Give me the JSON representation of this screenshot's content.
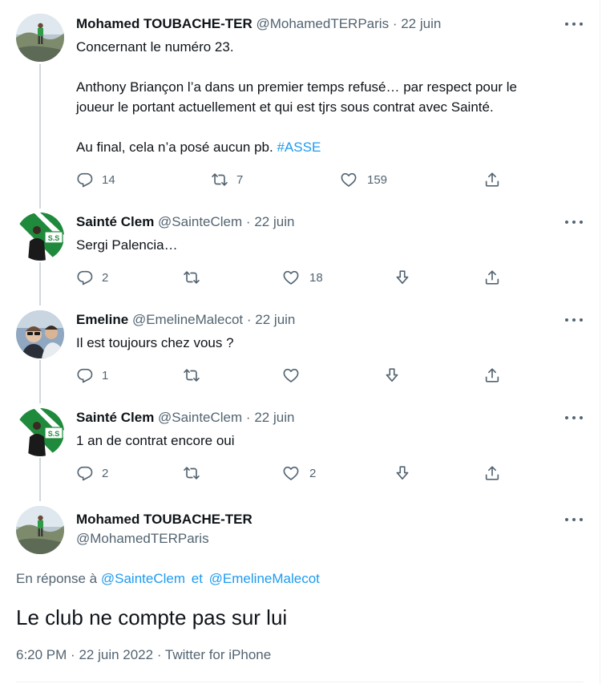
{
  "tweets": [
    {
      "name": "Mohamed TOUBACHE-TER",
      "handle": "@MohamedTERParis",
      "date": "22 juin",
      "lines": [
        "Concernant le numéro 23.",
        "Anthony Briançon l’a dans un premier temps refusé… par respect pour le",
        "joueur le portant actuellement et qui est tjrs sous contrat avec Sainté.",
        "Au final, cela n’a posé aucun pb."
      ],
      "hashtag": "#ASSE",
      "replies": "14",
      "retweets": "7",
      "likes": "159"
    },
    {
      "name": "Sainté Clem",
      "handle": "@SainteClem",
      "date": "22 juin",
      "lines": [
        "Sergi Palencia…"
      ],
      "replies": "2",
      "retweets": "",
      "likes": "18"
    },
    {
      "name": "Emeline",
      "handle": "@EmelineMalecot",
      "date": "22 juin",
      "lines": [
        "Il est toujours chez vous ?"
      ],
      "replies": "1",
      "retweets": "",
      "likes": ""
    },
    {
      "name": "Sainté Clem",
      "handle": "@SainteClem",
      "date": "22 juin",
      "lines": [
        "1 an de contrat encore oui"
      ],
      "replies": "2",
      "retweets": "",
      "likes": "2"
    }
  ],
  "main_tweet": {
    "name": "Mohamed TOUBACHE-TER",
    "handle": "@MohamedTERParis",
    "reply_prefix": "En réponse à",
    "reply_user1": "@SainteClem",
    "reply_and": "et",
    "reply_user2": "@EmelineMalecot",
    "text": "Le club ne compte pas sur lui",
    "time": "6:20 PM",
    "date": "22 juin 2022",
    "source": "Twitter for iPhone"
  },
  "separator": "·",
  "icons": {
    "reply": "reply-icon",
    "retweet": "retweet-icon",
    "like": "like-icon",
    "downvote": "downvote-icon",
    "share": "share-icon",
    "more": "more-icon"
  },
  "colors": {
    "link": "#1d9bf0",
    "muted": "#536471",
    "text": "#0f1419",
    "asse_green": "#1f8a3c"
  }
}
